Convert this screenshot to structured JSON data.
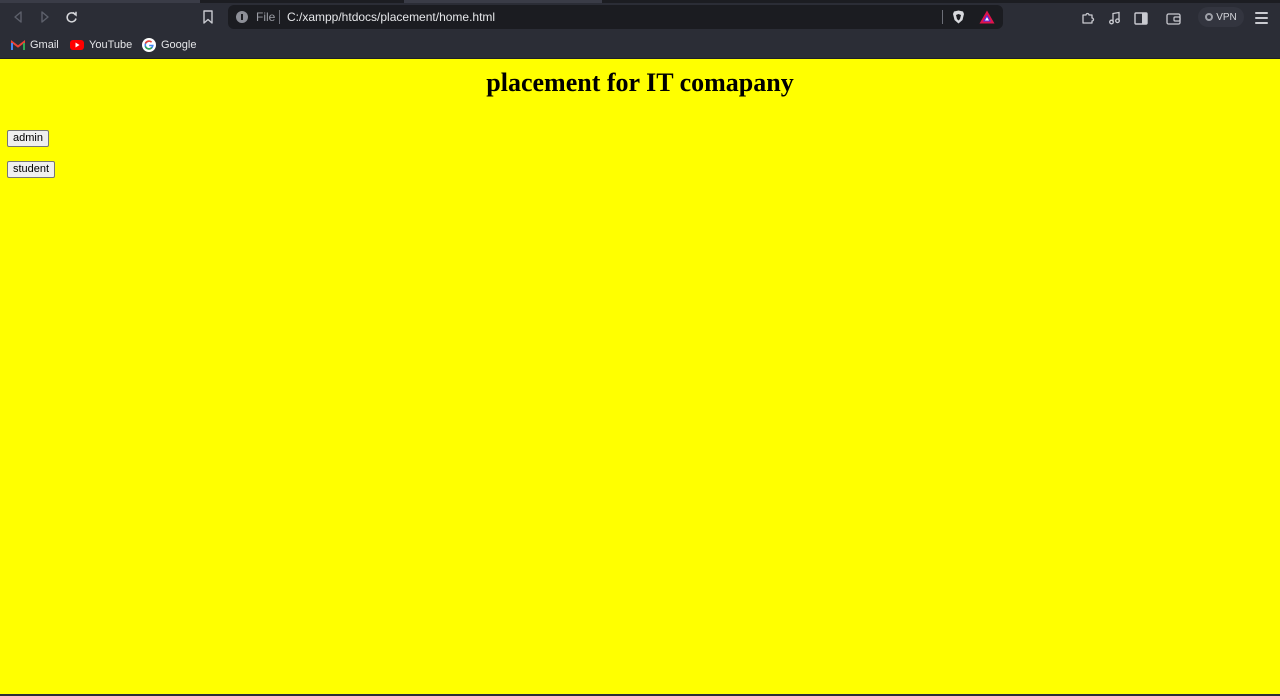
{
  "browser": {
    "address_bar": {
      "scheme_label": "File",
      "url": "C:/xampp/htdocs/placement/home.html"
    },
    "icons": {
      "back": "back-arrow-icon",
      "forward": "forward-arrow-icon",
      "reload": "reload-icon",
      "bookmark": "bookmark-icon",
      "site_info": "info-icon",
      "shields": "brave-shield-icon",
      "rewards": "brave-rewards-icon",
      "extensions": "puzzle-icon",
      "media": "music-note-icon",
      "sidebar": "sidebar-icon",
      "wallet": "wallet-icon",
      "menu": "hamburger-menu-icon"
    },
    "vpn_label": "VPN",
    "bookmarks": [
      {
        "label": "Gmail",
        "icon": "gmail-icon"
      },
      {
        "label": "YouTube",
        "icon": "youtube-icon"
      },
      {
        "label": "Google",
        "icon": "google-icon"
      }
    ]
  },
  "page": {
    "background": "#ffff00",
    "title": "placement for IT comapany",
    "buttons": {
      "admin": "admin",
      "student": "student"
    }
  }
}
